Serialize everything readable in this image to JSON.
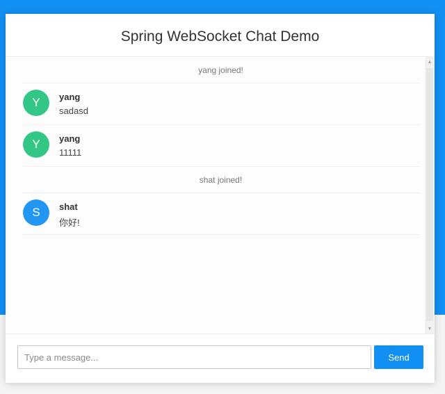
{
  "header": {
    "title": "Spring WebSocket Chat Demo"
  },
  "messages": [
    {
      "type": "event",
      "text": "yang joined!"
    },
    {
      "type": "chat",
      "sender": "yang",
      "initial": "Y",
      "content": "sadasd",
      "avatar_color": "#32c787"
    },
    {
      "type": "chat",
      "sender": "yang",
      "initial": "Y",
      "content": "11111",
      "avatar_color": "#32c787"
    },
    {
      "type": "event",
      "text": "shat joined!"
    },
    {
      "type": "chat",
      "sender": "shat",
      "initial": "S",
      "content": "你好!",
      "avatar_color": "#2196f3"
    }
  ],
  "scrollbar": {
    "up_icon": "scroll-up-arrow-icon",
    "down_icon": "scroll-down-arrow-icon"
  },
  "composer": {
    "input_value": "",
    "placeholder": "Type a message...",
    "send_label": "Send"
  },
  "colors": {
    "page_background": "#128ff2",
    "accent": "#128ff2",
    "avatar_green": "#32c787",
    "avatar_blue": "#2196f3"
  }
}
